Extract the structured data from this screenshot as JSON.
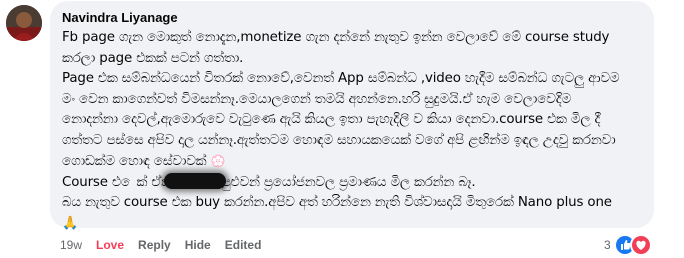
{
  "comment": {
    "author": "Navindra Liyanage",
    "lines": [
      "Fb page ගැන මොකුත් නොදැන,monetize ගැන දන්නේ නැතුව ඉන්න වෙලාවේ මේ course study",
      "කරලා page එකක් පටන් ගත්තා.",
      "Page එක සම්බන්ධයෙන් විතරක් නොවේ,වෙනත් App සම්බන්ධ ,video හැදීම සම්බන්ධ ගැටලු ආවම",
      "මං වෙන කාගෙන්වත් විමසන්නෑ.මෙයාලගෙන් තමයි අහන්නෙ.හරි සුදුමයි.ඒ හැම වෙලාවෙදිම",
      "නොදන්නා දෙවල්,ඇමොරුවෙ වැටුණෙ ඇයි කියල ඉතා පැහැදිලි ව කියා දෙනවා.course එක මිල දී",
      "ගත්තට පස්සෙ අපිව දාල යන්නෑ.ඇත්තටම හොඳම සහායකයෙක් වගේ අපි ළඟින්ම ඉඳල උදවු කරනවා",
      "ගොඩක්ම හොඳ සේවාවක්",
      "Course එ      ෙක් ඒකින් ගන්න පුළුවන් ප්‍රයෝජනවල ප්‍රමාණය මිල කරන්න බෑ.",
      "බය නැතුව course එක buy කරන්න.අපිව අත් හරින්නෙ නැති විශ්වාසදායි මිතුරෙක් Nano plus one"
    ],
    "flower_glyph": "💮",
    "pray_glyph": "🙏"
  },
  "actions": {
    "time": "19w",
    "love": "Love",
    "reply": "Reply",
    "hide": "Hide",
    "edited": "Edited"
  },
  "reactions": {
    "count": "3",
    "like_color": "#1877f2",
    "love_color": "#f33e58"
  }
}
